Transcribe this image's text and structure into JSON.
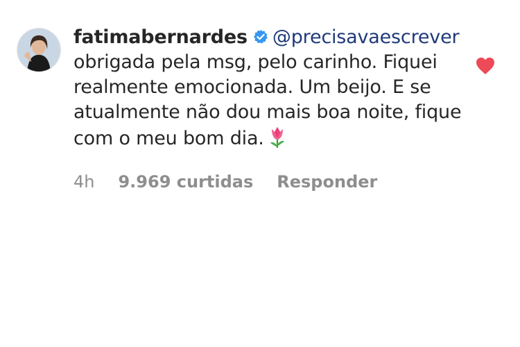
{
  "comment": {
    "username": "fatimabernardes",
    "verified": true,
    "mention": "@precisavaescrever",
    "text": "obrigada pela msg, pelo carinho. Fiquei realmente emocionada. Um beijo. E se atualmente não dou mais boa noite, fique com o meu bom dia.",
    "emoji": "tulip-icon"
  },
  "meta": {
    "time": "4h",
    "likes": "9.969 curtidas",
    "reply_label": "Responder"
  },
  "icons": {
    "verified": "verified-badge-icon",
    "like": "heart-icon"
  },
  "colors": {
    "heart": "#ed4956",
    "verified": "#3897f0",
    "mention": "#1f3a78",
    "meta": "#8e8e8e"
  }
}
